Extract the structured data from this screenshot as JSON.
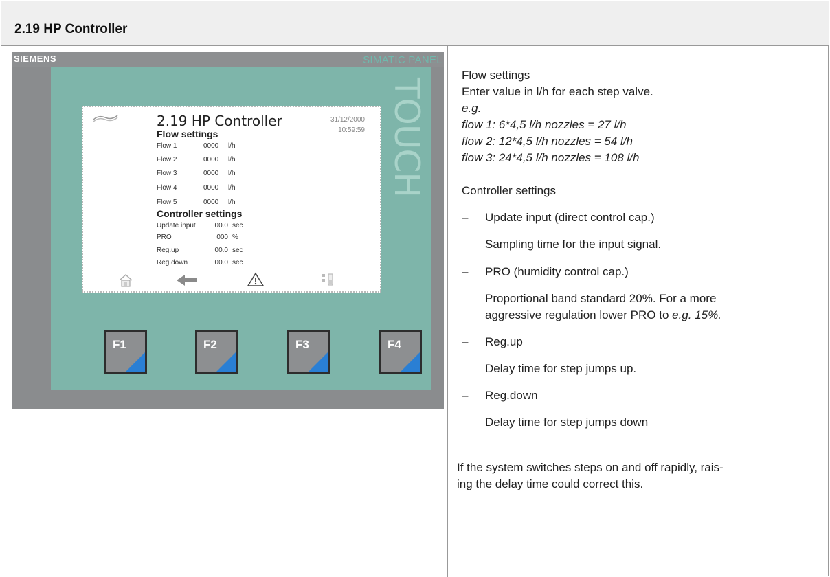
{
  "header": {
    "title": "2.19 HP Controller"
  },
  "panel": {
    "brand": "SIEMENS",
    "model": "SIMATIC PANEL",
    "touch_label": "TOUCH",
    "screen": {
      "title": "2.19 HP Controller",
      "date": "31/12/2000",
      "time": "10:59:59",
      "flow_heading": "Flow settings",
      "flows": [
        {
          "label": "Flow 1",
          "value": "0000",
          "unit": "l/h"
        },
        {
          "label": "Flow 2",
          "value": "0000",
          "unit": "l/h"
        },
        {
          "label": "Flow 3",
          "value": "0000",
          "unit": "l/h"
        },
        {
          "label": "Flow 4",
          "value": "0000",
          "unit": "l/h"
        },
        {
          "label": "Flow 5",
          "value": "0000",
          "unit": "l/h"
        }
      ],
      "controller_heading": "Controller settings",
      "controller_rows": [
        {
          "label": "Update input",
          "value": "00.0",
          "unit": "sec"
        },
        {
          "label": "PRO",
          "value": "000",
          "unit": "%"
        },
        {
          "label": "Reg.up",
          "value": "00.0",
          "unit": "sec"
        },
        {
          "label": "Reg.down",
          "value": "00.0",
          "unit": "sec"
        }
      ]
    },
    "function_keys": [
      "F1",
      "F2",
      "F3",
      "F4"
    ],
    "colors": {
      "bezel": "#7eb5aa",
      "key_accent": "#2a7fd4"
    }
  },
  "description": {
    "flow_title": "Flow settings",
    "flow_intro": "Enter value in l/h for each step valve.",
    "eg": "e.g.",
    "examples": [
      "flow 1:  6*4,5 l/h nozzles = 27 l/h",
      "flow 2: 12*4,5 l/h nozzles = 54 l/h",
      "flow 3: 24*4,5 l/h nozzles = 108 l/h"
    ],
    "controller_title": "Controller settings",
    "bullet_dash": "–",
    "items": [
      {
        "name": "Update input (direct control cap.)",
        "desc": "Sampling time for the input signal."
      },
      {
        "name": "PRO (humidity control cap.)",
        "desc_line1": "Proportional band standard 20%. For a more",
        "desc_line2_a": "aggressive regulation lower PRO  to ",
        "desc_line2_b": "e.g. 15%."
      },
      {
        "name": "Reg.up",
        "desc": "Delay time for step jumps up."
      },
      {
        "name": "Reg.down",
        "desc": "Delay time for step jumps down"
      }
    ],
    "footer_line1": "If the system switches steps on and off rapidly, rais-",
    "footer_line2": "ing the delay time could correct this."
  }
}
